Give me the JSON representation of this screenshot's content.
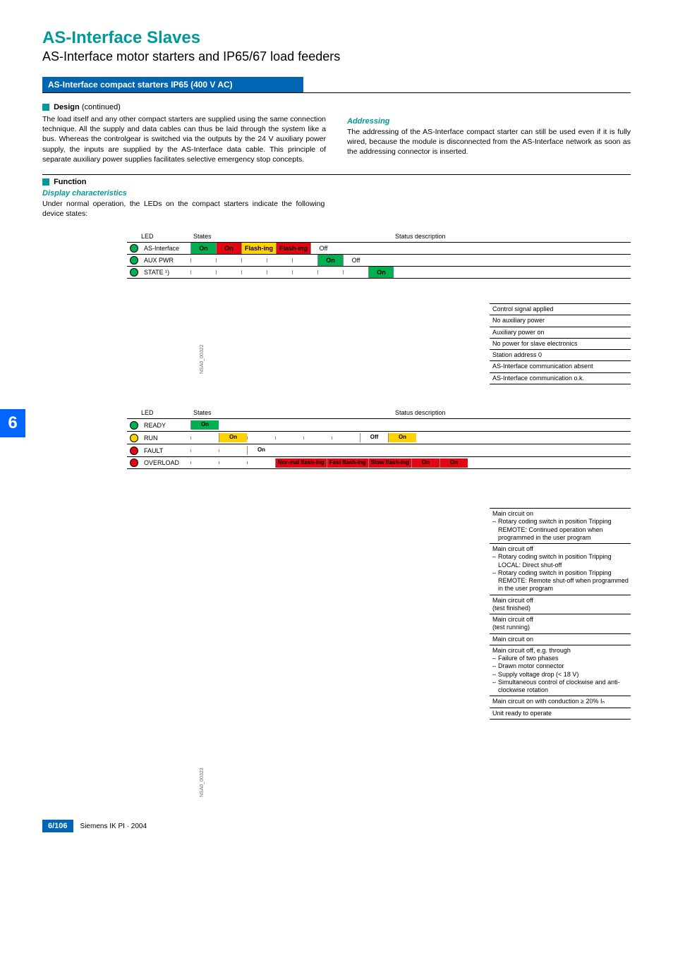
{
  "header": {
    "title": "AS-Interface Slaves",
    "subtitle": "AS-Interface motor starters and IP65/67 load feeders"
  },
  "blue_bar": "AS-Interface compact starters IP65 (400 V AC)",
  "sections": {
    "design": {
      "heading": "Design",
      "continued": "(continued)",
      "body_left": "The load itself and any other compact starters are supplied using the same connection technique. All the supply and data cables can thus be laid through the system like a bus. Whereas the controlgear is switched via the outputs by the 24 V auxiliary power supply, the inputs are supplied by the AS-Interface data cable. This principle of separate auxiliary power supplies facilitates selective emergency stop concepts.",
      "addressing_head": "Addressing",
      "body_right": "The addressing of the AS-Interface compact starter can still be used even if it is fully wired, because the module is disconnected from the AS-Interface network as soon as the addressing connector is inserted."
    },
    "function": {
      "heading": "Function",
      "display_head": "Display characteristics",
      "display_body": "Under normal operation, the LEDs on the compact starters indicate the following device states:"
    }
  },
  "diagram1": {
    "cols": {
      "led": "LED",
      "states": "States",
      "status": "Status description"
    },
    "rows": [
      {
        "led": "green",
        "label": "AS-Interface",
        "cells": [
          {
            "t": "On",
            "c": "green"
          },
          {
            "t": "On",
            "c": "red"
          },
          {
            "t": "Flash-ing",
            "c": "yellow"
          },
          {
            "t": "Flash-ing",
            "c": "red"
          },
          {
            "t": "Off",
            "c": "plain"
          }
        ]
      },
      {
        "led": "green",
        "label": "AUX PWR",
        "cells": [
          {
            "t": "",
            "c": "plain"
          },
          {
            "t": "",
            "c": "plain"
          },
          {
            "t": "",
            "c": "plain"
          },
          {
            "t": "",
            "c": "plain"
          },
          {
            "t": "",
            "c": "plain"
          },
          {
            "t": "On",
            "c": "green"
          },
          {
            "t": "Off",
            "c": "plain"
          }
        ]
      },
      {
        "led": "green",
        "label": "STATE ¹)",
        "cells": [
          {
            "t": "",
            "c": "plain"
          },
          {
            "t": "",
            "c": "plain"
          },
          {
            "t": "",
            "c": "plain"
          },
          {
            "t": "",
            "c": "plain"
          },
          {
            "t": "",
            "c": "plain"
          },
          {
            "t": "",
            "c": "plain"
          },
          {
            "t": "",
            "c": "plain"
          },
          {
            "t": "On",
            "c": "green"
          }
        ]
      }
    ],
    "desc": [
      "Control signal applied",
      "No auxiliary power",
      "Auxiliary power on",
      "No power for slave electronics",
      "Station address 0",
      "AS-Interface communication absent",
      "AS-Interface communication o.k."
    ],
    "ref": "NSA0_00322"
  },
  "diagram2": {
    "cols": {
      "led": "LED",
      "states": "States",
      "status": "Status description"
    },
    "rows": [
      {
        "led": "green",
        "label": "READY",
        "cells": [
          {
            "t": "On",
            "c": "green"
          }
        ]
      },
      {
        "led": "yellow",
        "label": "RUN",
        "cells": [
          {
            "t": "",
            "c": "plain"
          },
          {
            "t": "On",
            "c": "yellow"
          },
          {
            "t": "",
            "c": "plain"
          },
          {
            "t": "",
            "c": "plain"
          },
          {
            "t": "",
            "c": "plain"
          },
          {
            "t": "",
            "c": "plain"
          },
          {
            "t": "Off",
            "c": "plain"
          },
          {
            "t": "On",
            "c": "yellow"
          }
        ]
      },
      {
        "led": "red",
        "label": "FAULT",
        "cells": [
          {
            "t": "",
            "c": "plain"
          },
          {
            "t": "",
            "c": "plain"
          },
          {
            "t": "On",
            "c": "plain"
          }
        ]
      },
      {
        "led": "red",
        "label": "OVERLOAD",
        "cells": [
          {
            "t": "",
            "c": "plain"
          },
          {
            "t": "",
            "c": "plain"
          },
          {
            "t": "",
            "c": "plain"
          },
          {
            "t": "Nor-mal flash-ing",
            "c": "red"
          },
          {
            "t": "Fast flash-ing",
            "c": "red"
          },
          {
            "t": "Slow flash-ing",
            "c": "red"
          },
          {
            "t": "On",
            "c": "red"
          },
          {
            "t": "On",
            "c": "red"
          }
        ]
      }
    ],
    "desc": [
      {
        "main": "Main circuit on",
        "sub": [
          "Rotary coding switch in position Tripping REMOTE: Continued operation when programmed in the user program"
        ]
      },
      {
        "main": "Main circuit off",
        "sub": [
          "Rotary coding switch in position Tripping LOCAL: Direct shut-off",
          "Rotary coding switch in position Tripping REMOTE: Remote shut-off when programmed in the user program"
        ]
      },
      {
        "main": "Main circuit off",
        "note": "(test finished)"
      },
      {
        "main": "Main circuit off",
        "note": "(test running)"
      },
      {
        "main": "Main circuit on"
      },
      {
        "main": "Main circuit off, e.g. through",
        "sub": [
          "Failure of two phases",
          "Drawn motor connector",
          "Supply voltage drop (< 18 V)",
          "Simultaneous control of clockwise and anti-clockwise rotation"
        ]
      },
      {
        "main": "Main circuit on with conduction ≥ 20%  Iₙ"
      },
      {
        "main": "Unit ready to operate"
      }
    ],
    "ref": "NSA0_00323"
  },
  "chapter": "6",
  "page_number": "6/106",
  "footer": "Siemens IK PI · 2004",
  "chart_data": [
    {
      "type": "table",
      "title": "LED status diagram 1 (AS-Interface / AUX PWR / STATE)",
      "columns": [
        "LED",
        "States…",
        "Status description"
      ],
      "rows": [
        [
          "AS-Interface",
          "On (green) | On (red) | Flashing (yellow) | Flashing (red) | Off",
          "AS-Interface communication o.k. | absent | Station address 0 | No power for slave electronics"
        ],
        [
          "AUX PWR",
          "On | Off",
          "Auxiliary power on | No auxiliary power"
        ],
        [
          "STATE ¹)",
          "On",
          "Control signal applied"
        ]
      ]
    },
    {
      "type": "table",
      "title": "LED status diagram 2 (READY / RUN / FAULT / OVERLOAD)",
      "columns": [
        "LED",
        "States…",
        "Status description"
      ],
      "rows": [
        [
          "READY",
          "On",
          "Unit ready to operate"
        ],
        [
          "RUN",
          "On | Off | On",
          "Main circuit on with conduction ≥ 20% Iₙ | Main circuit off … | Main circuit on …"
        ],
        [
          "FAULT",
          "On",
          "Main circuit off, e.g. through failure of two phases, drawn motor connector, supply voltage drop (<18 V), simultaneous control of CW/CCW rotation"
        ],
        [
          "OVERLOAD",
          "Normal flashing | Fast flashing | Slow flashing | On | On",
          "Main circuit on | off (test running) | off (test finished) | off … | on …"
        ]
      ]
    }
  ]
}
